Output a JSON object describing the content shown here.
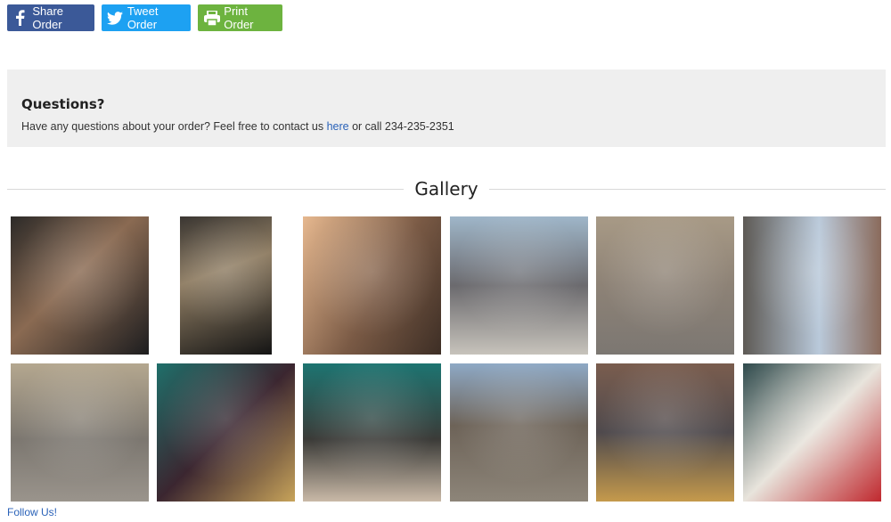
{
  "share": {
    "facebook_label": "Share Order",
    "twitter_label": "Tweet Order",
    "print_label": "Print Order",
    "colors": {
      "facebook": "#3b5998",
      "twitter": "#1da1f2",
      "print": "#6db33f"
    }
  },
  "questions": {
    "heading": "Questions?",
    "text_before": "Have any questions about your order? Feel free to contact us ",
    "link_text": "here",
    "text_after": " or call 234-235-2351"
  },
  "gallery": {
    "title": "Gallery",
    "images": [
      {
        "subject": "two women in leather jackets at night"
      },
      {
        "subject": "couple on city street at night"
      },
      {
        "subject": "woman in fur coat"
      },
      {
        "subject": "woman with white hair on street"
      },
      {
        "subject": "woman in red jacket by columns"
      },
      {
        "subject": "city street with buildings"
      },
      {
        "subject": "woman walking on busy street"
      },
      {
        "subject": "man in suit sitting"
      },
      {
        "subject": "couple in teal room"
      },
      {
        "subject": "person walking dog on street"
      },
      {
        "subject": "city street with taxi"
      },
      {
        "subject": "coffee cups and red teapot"
      }
    ]
  },
  "footer": {
    "follow_label": "Follow Us!"
  }
}
